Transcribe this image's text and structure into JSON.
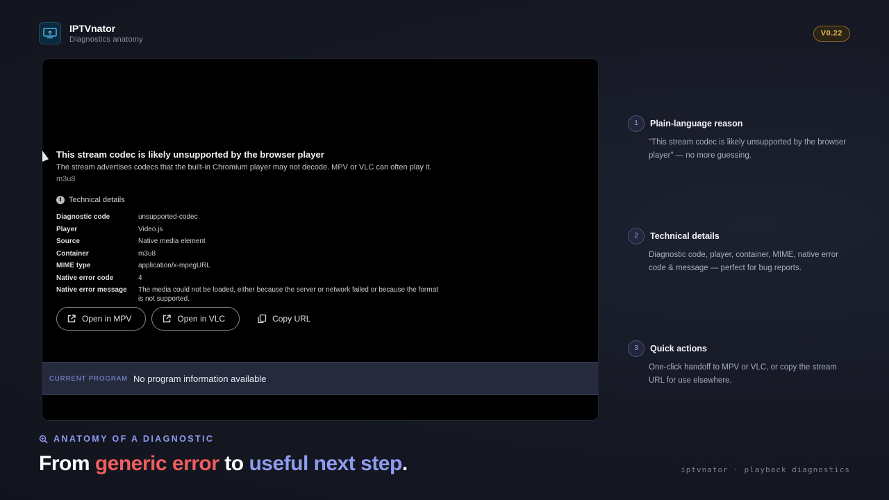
{
  "app": {
    "title": "IPTVnator",
    "subtitle": "Diagnostics anatomy",
    "version": "V0.22"
  },
  "error": {
    "title": "This stream codec is likely unsupported by the browser player",
    "description": "The stream advertises codecs that the built-in Chromium player may not decode. MPV or VLC can often play it.",
    "format": "m3u8"
  },
  "technical": {
    "header": "Technical details",
    "rows": [
      {
        "key": "Diagnostic code",
        "value": "unsupported-codec"
      },
      {
        "key": "Player",
        "value": "Video.js"
      },
      {
        "key": "Source",
        "value": "Native media element"
      },
      {
        "key": "Container",
        "value": "m3u8"
      },
      {
        "key": "MIME type",
        "value": "application/x-mpegURL"
      },
      {
        "key": "Native error code",
        "value": "4"
      },
      {
        "key": "Native error message",
        "value": "The media could not be loaded, either because the server or network failed or because the format is not supported."
      }
    ]
  },
  "actions": {
    "open_mpv": "Open in MPV",
    "open_vlc": "Open in VLC",
    "copy_url": "Copy URL"
  },
  "program": {
    "label": "CURRENT PROGRAM",
    "value": "No program information available"
  },
  "callouts": [
    {
      "num": "1",
      "title": "Plain-language reason",
      "body": "\"This stream codec is likely unsupported by the browser player\" — no more guessing."
    },
    {
      "num": "2",
      "title": "Technical details",
      "body": "Diagnostic code, player, container, MIME, native error code & message — perfect for bug reports."
    },
    {
      "num": "3",
      "title": "Quick actions",
      "body": "One-click handoff to MPV or VLC, or copy the stream URL for use elsewhere."
    }
  ],
  "caption": {
    "label": "ANATOMY OF A DIAGNOSTIC",
    "headline_1": "From ",
    "headline_2": "generic error",
    "headline_3": " to ",
    "headline_4": "useful next step",
    "headline_5": ".",
    "footer": "iptvnator · playback diagnostics"
  },
  "colors": {
    "accent_blue": "#8e9bf0",
    "accent_red": "#ef5d5d",
    "badge_gold": "#e8b85a"
  }
}
